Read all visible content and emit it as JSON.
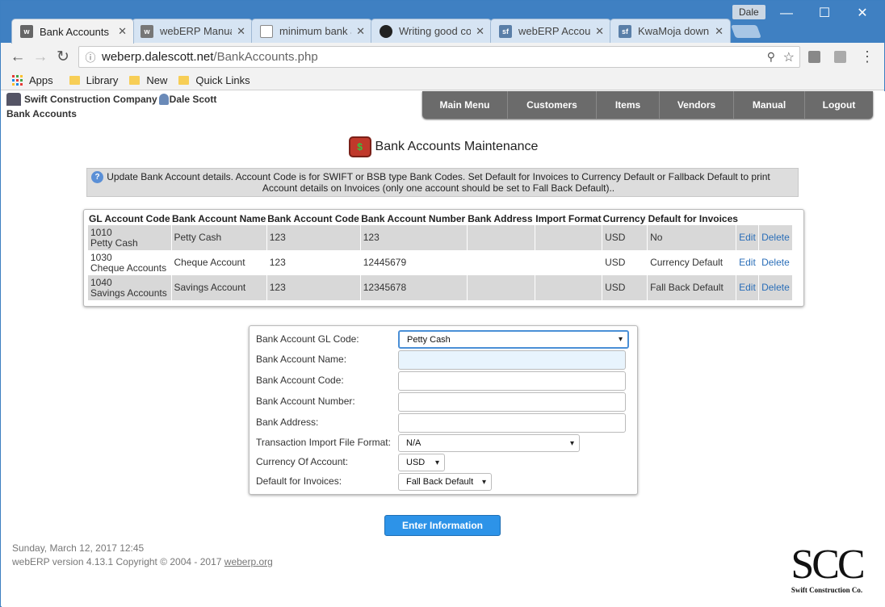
{
  "browser": {
    "tabs": [
      {
        "title": "Bank Accounts",
        "favicon": "webERP",
        "active": true
      },
      {
        "title": "webERP Manual",
        "favicon": "webERP",
        "active": false
      },
      {
        "title": "minimum bank a",
        "favicon": "doc",
        "active": false
      },
      {
        "title": "Writing good co",
        "favicon": "github",
        "active": false
      },
      {
        "title": "webERP Accoun",
        "favicon": "sf",
        "active": false
      },
      {
        "title": "KwaMoja downl",
        "favicon": "sf",
        "active": false
      }
    ],
    "profile": "Dale",
    "url_host": "weberp.dalescott.net",
    "url_path": "/BankAccounts.php",
    "bookmarks": [
      "Apps",
      "Library",
      "New",
      "Quick Links"
    ]
  },
  "header": {
    "company": "Swift Construction Company",
    "user": "Dale Scott",
    "breadcrumb": "Bank Accounts"
  },
  "nav": [
    {
      "label": "Main Menu"
    },
    {
      "label": "Customers"
    },
    {
      "label": "Items"
    },
    {
      "label": "Vendors"
    },
    {
      "label": "Manual"
    },
    {
      "label": "Logout"
    }
  ],
  "page": {
    "title": "Bank Accounts Maintenance",
    "info": "Update Bank Account details. Account Code is for SWIFT or BSB type Bank Codes. Set Default for Invoices to Currency Default or Fallback Default to print Account details on Invoices (only one account should be set to Fall Back Default).."
  },
  "table": {
    "headers": [
      "GL Account Code",
      "Bank Account Name",
      "Bank Account Code",
      "Bank Account Number",
      "Bank Address",
      "Import Format",
      "Currency",
      "Default for Invoices"
    ],
    "rows": [
      {
        "gl_code": "1010",
        "gl_name": "Petty Cash",
        "name": "Petty Cash",
        "code": "123",
        "number": "123",
        "address": "",
        "import": "",
        "currency": "USD",
        "default": "No",
        "edit": "Edit",
        "delete": "Delete"
      },
      {
        "gl_code": "1030",
        "gl_name": "Cheque Accounts",
        "name": "Cheque Account",
        "code": "123",
        "number": "12445679",
        "address": "",
        "import": "",
        "currency": "USD",
        "default": "Currency Default",
        "edit": "Edit",
        "delete": "Delete"
      },
      {
        "gl_code": "1040",
        "gl_name": "Savings Accounts",
        "name": "Savings Account",
        "code": "123",
        "number": "12345678",
        "address": "",
        "import": "",
        "currency": "USD",
        "default": "Fall Back Default",
        "edit": "Edit",
        "delete": "Delete"
      }
    ]
  },
  "form": {
    "gl_code_label": "Bank Account GL Code:",
    "gl_code_value": "Petty Cash",
    "name_label": "Bank Account Name:",
    "name_value": "",
    "code_label": "Bank Account Code:",
    "code_value": "",
    "number_label": "Bank Account Number:",
    "number_value": "",
    "address_label": "Bank Address:",
    "address_value": "",
    "import_label": "Transaction Import File Format:",
    "import_value": "N/A",
    "currency_label": "Currency Of Account:",
    "currency_value": "USD",
    "default_label": "Default for Invoices:",
    "default_value": "Fall Back Default",
    "submit_label": "Enter Information"
  },
  "footer": {
    "datetime": "Sunday, March 12, 2017 12:45",
    "version": "webERP version 4.13.1 Copyright © 2004 - 2017",
    "link": "weberp.org"
  },
  "logo": {
    "big": "SCC",
    "small": "Swift Construction Co."
  },
  "colors": {
    "tabstrip": "#3f80c2",
    "nav": "#6b6b6b",
    "button": "#2d93e8",
    "link": "#2a6eb8"
  }
}
